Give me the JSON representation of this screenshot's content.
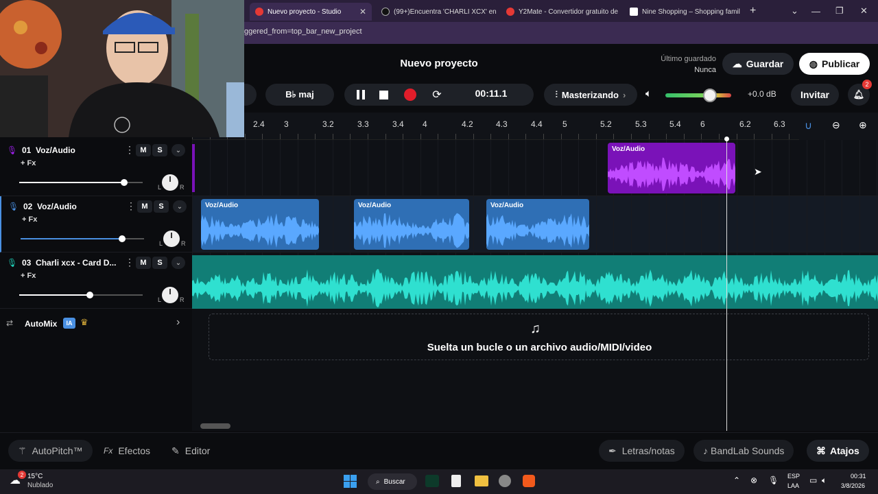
{
  "browser": {
    "tabs": [
      {
        "label": "Nuevo proyecto - Studio",
        "fav_color": "#e53935",
        "active": true
      },
      {
        "label": "(99+)Encuentra 'CHARLI XCX' en",
        "fav_color": "#111111"
      },
      {
        "label": "Y2Mate - Convertidor gratuito de",
        "fav_color": "#e53935"
      },
      {
        "label": "Nine Shopping – Shopping famil",
        "fav_color": "#ffffff"
      }
    ],
    "url": "ggered_from=top_bar_new_project",
    "new_tab": "+"
  },
  "app": {
    "title": "Nuevo proyecto",
    "last_saved_label": "Último guardado",
    "last_saved_value": "Nunca",
    "save_label": "Guardar",
    "publish_label": "Publicar",
    "key_label": "B♭ maj",
    "time": "00:11.1",
    "mastering_label": "Masterizando",
    "volume_db": "+0.0 dB",
    "invite_label": "Invitar",
    "notifications": "2"
  },
  "ruler": [
    "2.4",
    "3",
    "3.2",
    "3.3",
    "3.4",
    "4",
    "4.2",
    "4.3",
    "4.4",
    "5",
    "5.2",
    "5.3",
    "5.4",
    "6",
    "6.2",
    "6.3"
  ],
  "tracks": [
    {
      "num": "01",
      "name": "Voz/Audio",
      "mic_color": "#a020f0",
      "fx": "+ Fx",
      "volume_level": 0.85
    },
    {
      "num": "02",
      "name": "Voz/Audio",
      "mic_color": "#4a90e2",
      "fx": "+ Fx",
      "volume_level": 0.82
    },
    {
      "num": "03",
      "name": "Charli xcx - Card D...",
      "mic_color": "#1fd1b8",
      "fx": "+ Fx",
      "volume_level": 0.57
    }
  ],
  "mute_label": "M",
  "solo_label": "S",
  "pan_left": "L",
  "pan_right": "R",
  "clips": {
    "track1": [
      {
        "label": "Voz/Audio"
      }
    ],
    "track2": [
      {
        "label": "Voz/Audio"
      },
      {
        "label": "Voz/Audio"
      },
      {
        "label": "Voz/Audio"
      }
    ]
  },
  "automix": {
    "label": "AutoMix",
    "badge": "IA"
  },
  "drop_zone": "Suelta un bucle o un archivo audio/MIDI/video",
  "bottom": {
    "autopitch": "AutoPitch™",
    "fx_prefix": "Fx",
    "effects": "Efectos",
    "editor": "Editor",
    "lyrics": "Letras/notas",
    "sounds": "BandLab Sounds",
    "shortcuts": "Atajos"
  },
  "taskbar": {
    "temp": "15°C",
    "weather": "Nublado",
    "weather_badge": "2",
    "search": "Buscar",
    "lang": "ESP",
    "lang2": "LAA",
    "time": "00:31",
    "date": "3/8/2026"
  },
  "colors": {
    "track1_clip": "#7a12b8",
    "track1_wave": "#c04cff",
    "track2_clip": "#2f6fb5",
    "track2_wave": "#5aa8ff",
    "track3_bg": "#117e76",
    "track3_wave": "#2fe0d0"
  }
}
